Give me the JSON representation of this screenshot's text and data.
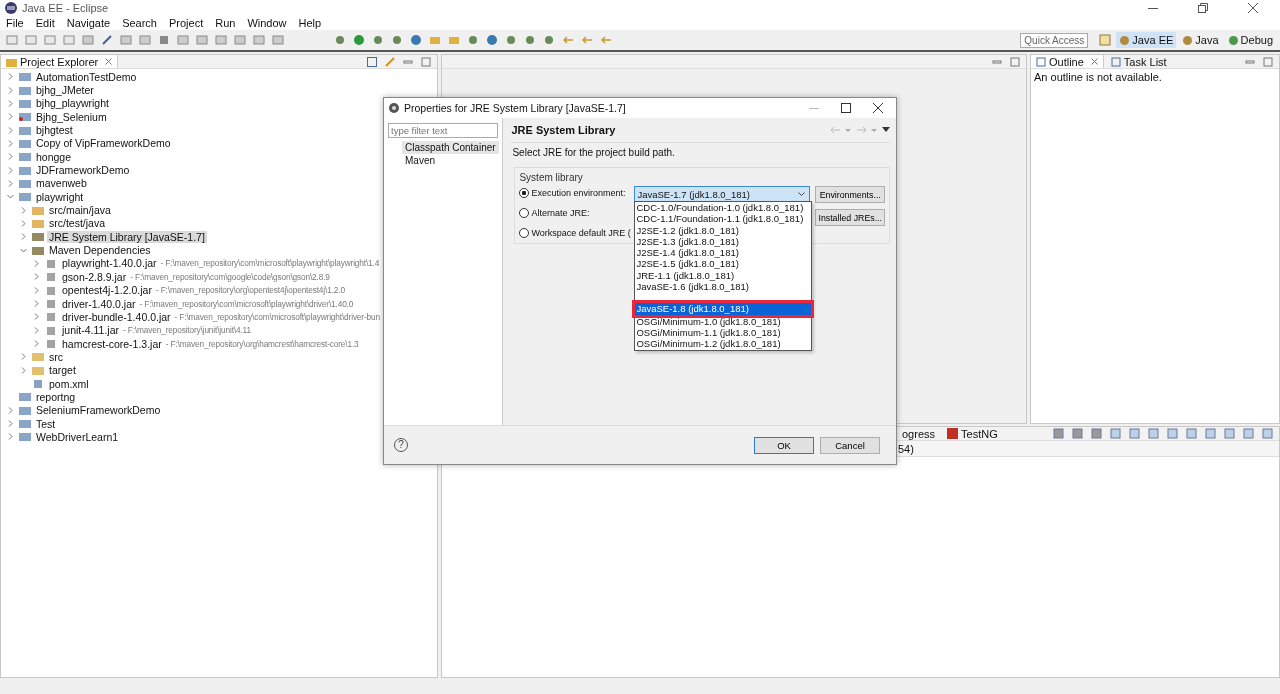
{
  "window": {
    "title": "Java EE - Eclipse"
  },
  "menu": [
    "File",
    "Edit",
    "Navigate",
    "Search",
    "Project",
    "Run",
    "Window",
    "Help"
  ],
  "quick_access": {
    "placeholder": "Quick Access"
  },
  "perspectives": [
    {
      "label": "Java EE",
      "selected": true
    },
    {
      "label": "Java",
      "selected": false
    },
    {
      "label": "Debug",
      "selected": false
    }
  ],
  "project_explorer": {
    "title": "Project Explorer",
    "tree": [
      {
        "label": "AutomationTestDemo",
        "kind": "project",
        "expanded": false,
        "selected": false
      },
      {
        "label": "bjhg_JMeter",
        "kind": "project",
        "expanded": false,
        "selected": false
      },
      {
        "label": "bjhg_playwright",
        "kind": "project",
        "expanded": false,
        "selected": false
      },
      {
        "label": "Bjhg_Selenium",
        "kind": "error",
        "expanded": false,
        "selected": false
      },
      {
        "label": "bjhgtest",
        "kind": "project",
        "expanded": false,
        "selected": false
      },
      {
        "label": "Copy of VipFrameworkDemo",
        "kind": "project",
        "expanded": false,
        "selected": false
      },
      {
        "label": "hongge",
        "kind": "project",
        "expanded": false,
        "selected": false
      },
      {
        "label": "JDFrameworkDemo",
        "kind": "project",
        "expanded": false,
        "selected": false
      },
      {
        "label": "mavenweb",
        "kind": "project",
        "expanded": false,
        "selected": false
      },
      {
        "label": "playwright",
        "kind": "project",
        "expanded": true,
        "selected": false,
        "children": [
          {
            "label": "src/main/java",
            "kind": "source",
            "expanded": false,
            "selected": false
          },
          {
            "label": "src/test/java",
            "kind": "source",
            "expanded": false,
            "selected": false
          },
          {
            "label": "JRE System Library [JavaSE-1.7]",
            "kind": "library",
            "expanded": false,
            "selected": true
          },
          {
            "label": "Maven Dependencies",
            "kind": "library",
            "expanded": true,
            "selected": false,
            "children": [
              {
                "label": "playwright-1.40.0.jar",
                "detail": "- F:\\maven_repository\\com\\microsoft\\playwright\\playwright\\1.4",
                "kind": "jar",
                "expanded": false,
                "selected": false
              },
              {
                "label": "gson-2.8.9.jar",
                "detail": "- F:\\maven_repository\\com\\google\\code\\gson\\gson\\2.8.9",
                "kind": "jar",
                "expanded": false,
                "selected": false
              },
              {
                "label": "opentest4j-1.2.0.jar",
                "detail": "- F:\\maven_repository\\org\\opentest4j\\opentest4j\\1.2.0",
                "kind": "jar",
                "expanded": false,
                "selected": false
              },
              {
                "label": "driver-1.40.0.jar",
                "detail": "- F:\\maven_repository\\com\\microsoft\\playwright\\driver\\1.40.0",
                "kind": "jar",
                "expanded": false,
                "selected": false
              },
              {
                "label": "driver-bundle-1.40.0.jar",
                "detail": "- F:\\maven_repository\\com\\microsoft\\playwright\\driver-bun",
                "kind": "jar",
                "expanded": false,
                "selected": false
              },
              {
                "label": "junit-4.11.jar",
                "detail": "- F:\\maven_repository\\junit\\junit\\4.11",
                "kind": "jar",
                "expanded": false,
                "selected": false
              },
              {
                "label": "hamcrest-core-1.3.jar",
                "detail": "- F:\\maven_repository\\org\\hamcrest\\hamcrest-core\\1.3",
                "kind": "jar",
                "expanded": false,
                "selected": false
              }
            ]
          },
          {
            "label": "src",
            "kind": "folder",
            "expanded": false,
            "selected": false
          },
          {
            "label": "target",
            "kind": "folder",
            "expanded": false,
            "selected": false
          },
          {
            "label": "pom.xml",
            "kind": "file",
            "selected": false
          }
        ]
      },
      {
        "label": "reportng",
        "kind": "plain",
        "selected": false
      },
      {
        "label": "SeleniumFrameworkDemo",
        "kind": "project",
        "expanded": false,
        "selected": false
      },
      {
        "label": "Test",
        "kind": "project",
        "expanded": false,
        "selected": false
      },
      {
        "label": "WebDriverLearn1",
        "kind": "project",
        "expanded": false,
        "selected": false
      }
    ]
  },
  "outline": {
    "tabs": [
      {
        "label": "Outline",
        "selected": true
      },
      {
        "label": "Task List",
        "selected": false
      }
    ],
    "message": "An outline is not available."
  },
  "bottom_panel": {
    "tabs": [
      {
        "label": "ogress",
        "selected": false
      },
      {
        "label": "TestNG",
        "selected": false
      }
    ],
    "line": "54)"
  },
  "dialog": {
    "title": "Properties for JRE System Library [JavaSE-1.7]",
    "filter": {
      "placeholder": "type filter text"
    },
    "nav": [
      {
        "label": "Classpath Container",
        "selected": true
      },
      {
        "label": "Maven",
        "selected": false
      }
    ],
    "page_title": "JRE System Library",
    "description": "Select JRE for the project build path.",
    "group_title": "System library",
    "radios": [
      {
        "label": "Execution environment:",
        "selected": true
      },
      {
        "label": "Alternate JRE:",
        "selected": false
      },
      {
        "label": "Workspace default JRE (",
        "selected": false
      }
    ],
    "combo": {
      "value": "JavaSE-1.7 (jdk1.8.0_181)"
    },
    "side_buttons": [
      "Environments...",
      "Installed JREs..."
    ],
    "options": [
      {
        "label": "CDC-1.0/Foundation-1.0 (jdk1.8.0_181)",
        "selected": false
      },
      {
        "label": "CDC-1.1/Foundation-1.1 (jdk1.8.0_181)",
        "selected": false
      },
      {
        "label": "J2SE-1.2 (jdk1.8.0_181)",
        "selected": false
      },
      {
        "label": "J2SE-1.3 (jdk1.8.0_181)",
        "selected": false
      },
      {
        "label": "J2SE-1.4 (jdk1.8.0_181)",
        "selected": false
      },
      {
        "label": "J2SE-1.5 (jdk1.8.0_181)",
        "selected": false
      },
      {
        "label": "JRE-1.1 (jdk1.8.0_181)",
        "selected": false
      },
      {
        "label": "JavaSE-1.6 (jdk1.8.0_181)",
        "selected": false
      },
      {
        "label": "JavaSE-1.8 (jdk1.8.0_181)",
        "selected": true
      },
      {
        "label": "OSGi/Minimum-1.0 (jdk1.8.0_181)",
        "selected": false
      },
      {
        "label": "OSGi/Minimum-1.1 (jdk1.8.0_181)",
        "selected": false
      },
      {
        "label": "OSGi/Minimum-1.2 (jdk1.8.0_181)",
        "selected": false
      }
    ],
    "help": "?",
    "buttons": [
      {
        "label": "OK",
        "default": true
      },
      {
        "label": "Cancel",
        "default": false
      }
    ]
  }
}
